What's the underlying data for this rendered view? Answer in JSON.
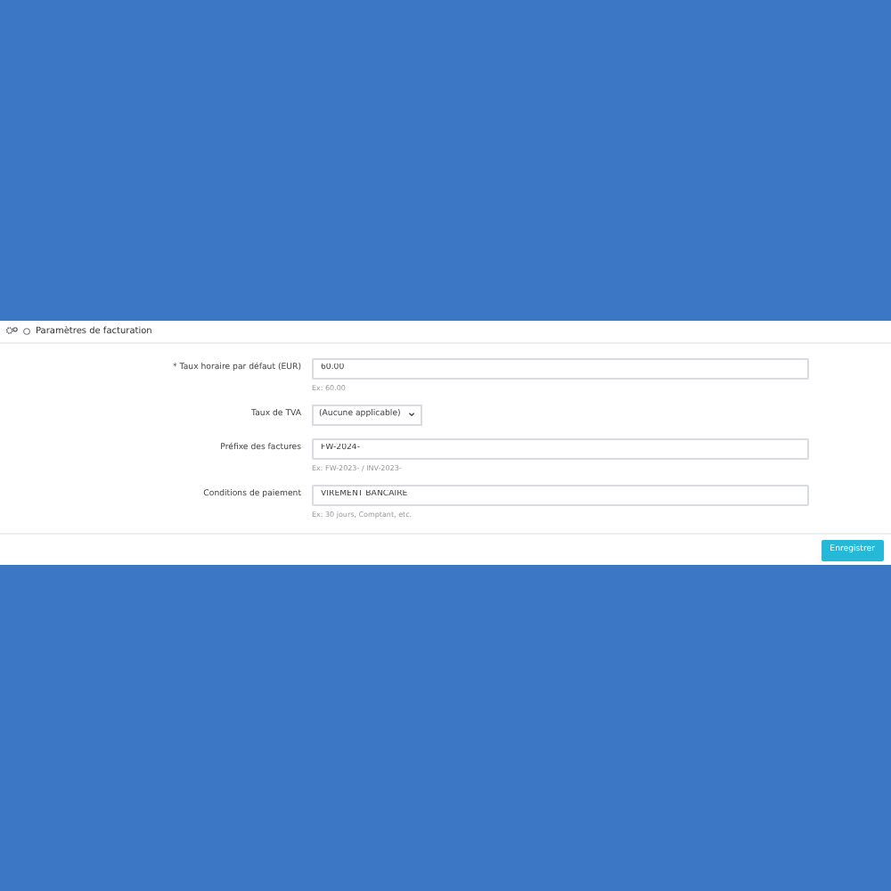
{
  "panel": {
    "title": "Paramètres de facturation"
  },
  "fields": [
    {
      "kind": "input",
      "label": "* Taux horaire par défaut (EUR)",
      "value": "60.00",
      "hint": "Ex: 60.00"
    },
    {
      "kind": "select",
      "label": "Taux de TVA",
      "value": "(Aucune applicable)"
    },
    {
      "kind": "input",
      "label": "Préfixe des factures",
      "value": "FW-2024-",
      "hint": "Ex: FW-2023- / INV-2023-"
    },
    {
      "kind": "input",
      "label": "Conditions de paiement",
      "value": "VIREMENT BANCAIRE",
      "hint": "Ex: 30 jours, Comptant, etc."
    }
  ],
  "save_button": "Enregistrer"
}
